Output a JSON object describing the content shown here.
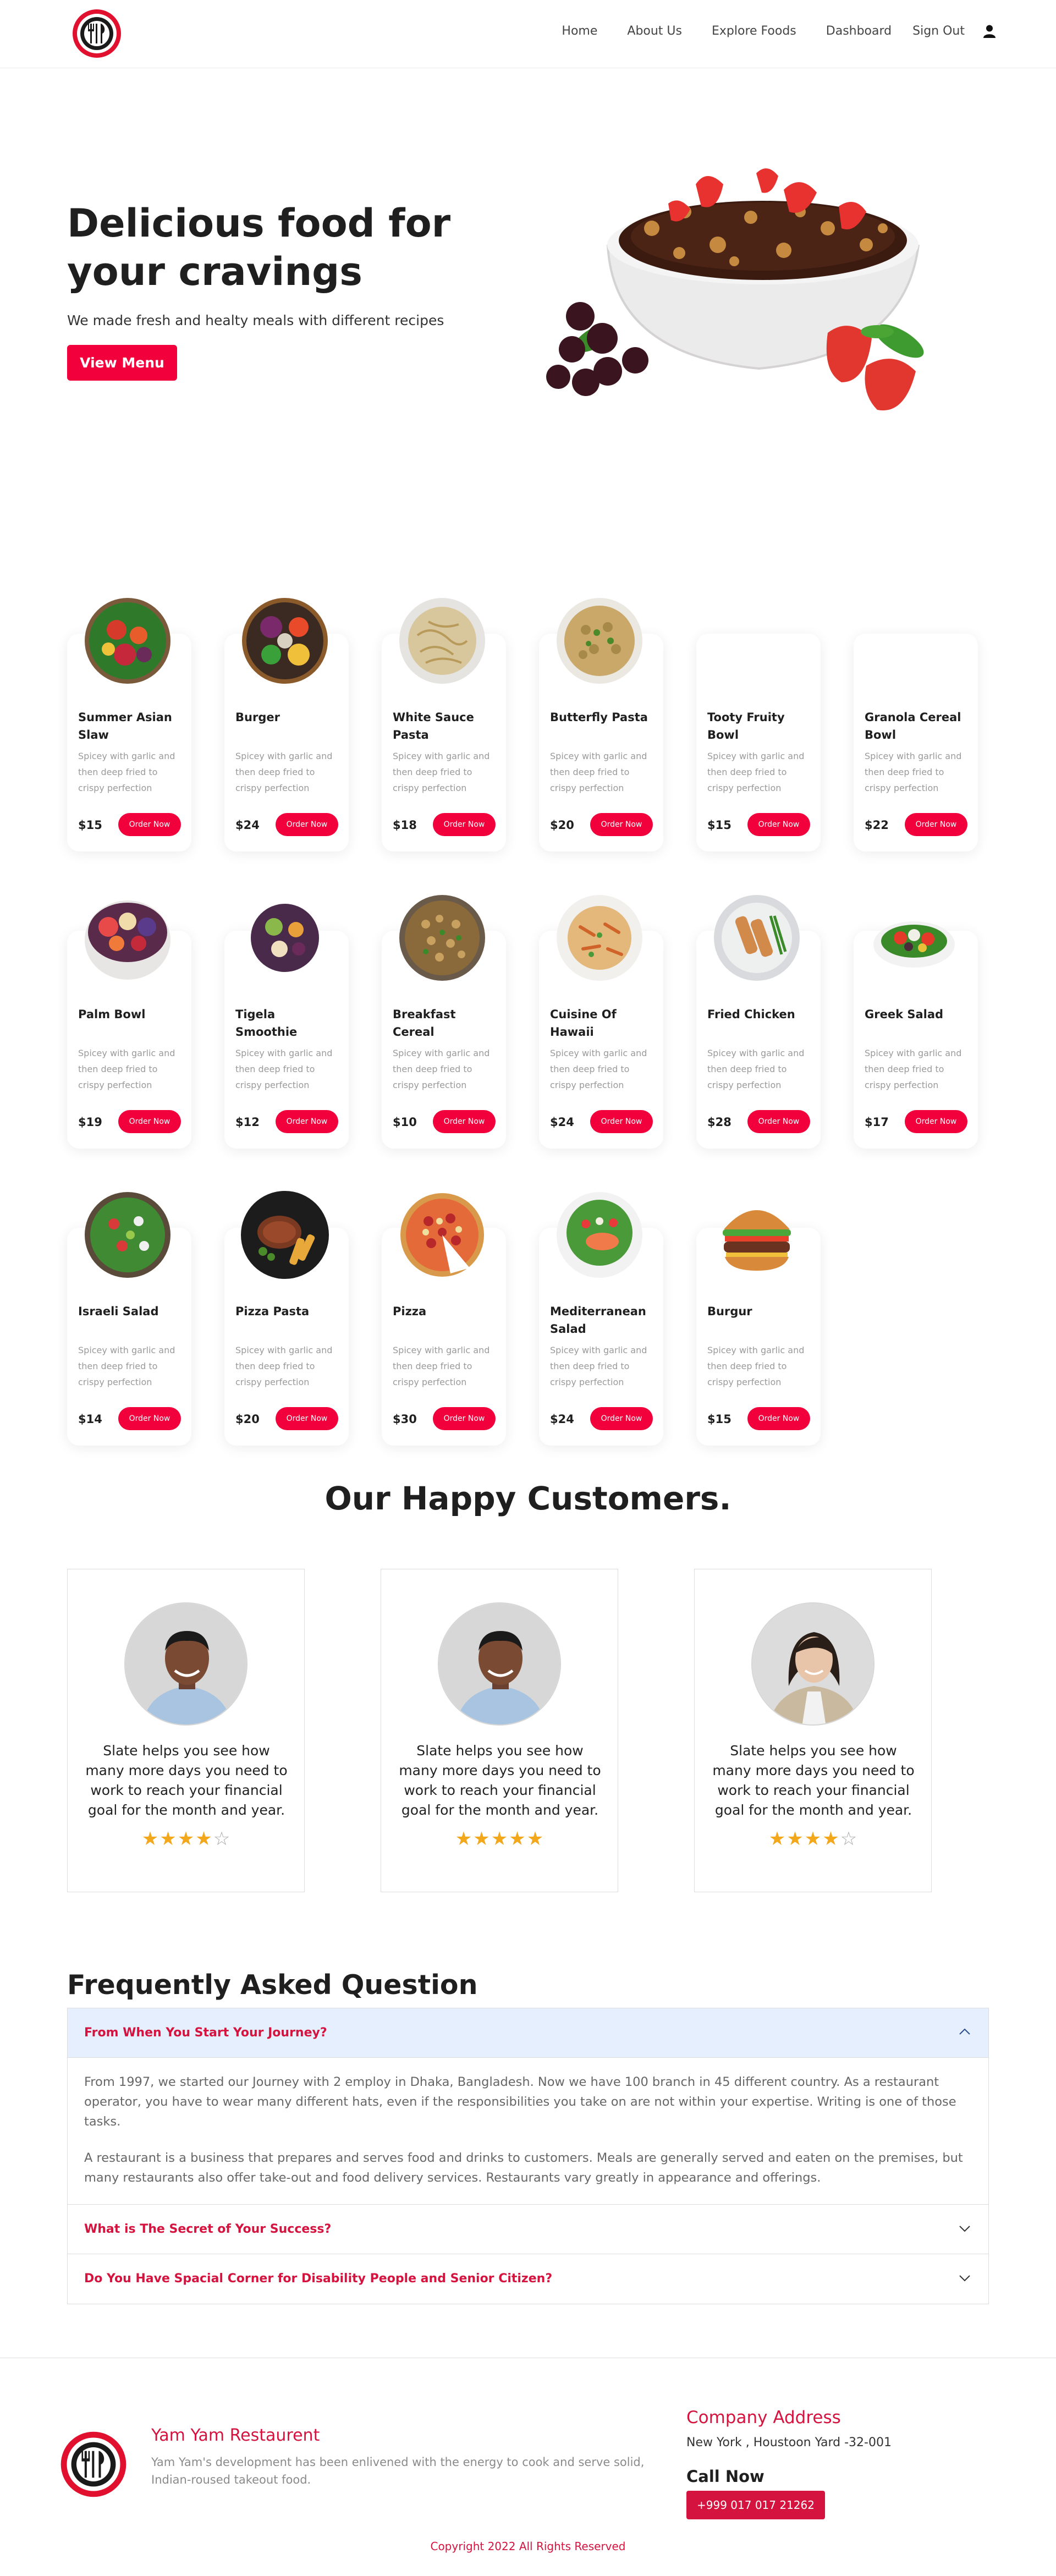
{
  "nav": {
    "items": [
      {
        "label": "Home",
        "icon": ""
      },
      {
        "label": "About Us",
        "icon": ""
      },
      {
        "label": "Explore Foods",
        "icon": ""
      },
      {
        "label": "Dashboard",
        "icon": ""
      },
      {
        "label": "Sign Out",
        "icon": ""
      }
    ],
    "user_icon": "user-icon",
    "logo_icon": "cutlery-logo"
  },
  "hero": {
    "title": "Delicious food for your cravings",
    "subtitle": "We made fresh and healty meals with different recipes",
    "button": "View Menu",
    "image": "chocolate-granola-bowl-with-strawberries"
  },
  "foods": [
    {
      "name": "Summer Asian Slaw",
      "desc": "Spicey with garlic and then deep fried to crispy perfection",
      "price": "$15",
      "button": "Order Now",
      "has_image": true,
      "image": "slaw-bowl"
    },
    {
      "name": "Burger",
      "desc": "Spicey with garlic and then deep fried to crispy perfection",
      "price": "$24",
      "button": "Order Now",
      "has_image": true,
      "image": "colorful-bowl"
    },
    {
      "name": "White Sauce Pasta",
      "desc": "Spicey with garlic and then deep fried to crispy perfection",
      "price": "$18",
      "button": "Order Now",
      "has_image": true,
      "image": "pasta-plate"
    },
    {
      "name": "Butterfly Pasta",
      "desc": "Spicey with garlic and then deep fried to crispy perfection",
      "price": "$20",
      "button": "Order Now",
      "has_image": true,
      "image": "farfalle-plate"
    },
    {
      "name": "Tooty Fruity Bowl",
      "desc": "Spicey with garlic and then deep fried to crispy perfection",
      "price": "$15",
      "button": "Order Now",
      "has_image": false,
      "image": ""
    },
    {
      "name": "Granola Cereal Bowl",
      "desc": "Spicey with garlic and then deep fried to crispy perfection",
      "price": "$22",
      "button": "Order Now",
      "has_image": false,
      "image": ""
    },
    {
      "name": "Palm Bowl",
      "desc": "Spicey with garlic and then deep fried to crispy perfection",
      "price": "$19",
      "button": "Order Now",
      "has_image": true,
      "image": "fruit-bowl"
    },
    {
      "name": "Tigela Smoothie",
      "desc": "Spicey with garlic and then deep fried to crispy perfection",
      "price": "$12",
      "button": "Order Now",
      "has_image": true,
      "image": "smoothie-bowl"
    },
    {
      "name": "Breakfast Cereal",
      "desc": "Spicey with garlic and then deep fried to crispy perfection",
      "price": "$10",
      "button": "Order Now",
      "has_image": true,
      "image": "cereal-bowl"
    },
    {
      "name": "Cuisine Of Hawaii",
      "desc": "Spicey with garlic and then deep fried to crispy perfection",
      "price": "$24",
      "button": "Order Now",
      "has_image": true,
      "image": "penne-plate"
    },
    {
      "name": "Fried Chicken",
      "desc": "Spicey with garlic and then deep fried to crispy perfection",
      "price": "$28",
      "button": "Order Now",
      "has_image": true,
      "image": "chicken-plate"
    },
    {
      "name": "Greek Salad",
      "desc": "Spicey with garlic and then deep fried to crispy perfection",
      "price": "$17",
      "button": "Order Now",
      "has_image": true,
      "image": "salad-bowl"
    },
    {
      "name": "Israeli Salad",
      "desc": "Spicey with garlic and then deep fried to crispy perfection",
      "price": "$14",
      "button": "Order Now",
      "has_image": true,
      "image": "green-salad-bowl"
    },
    {
      "name": "Pizza Pasta",
      "desc": "Spicey with garlic and then deep fried to crispy perfection",
      "price": "$20",
      "button": "Order Now",
      "has_image": true,
      "image": "steak-plate"
    },
    {
      "name": "Pizza",
      "desc": "Spicey with garlic and then deep fried to crispy perfection",
      "price": "$30",
      "button": "Order Now",
      "has_image": true,
      "image": "pizza"
    },
    {
      "name": "Mediterranean Salad",
      "desc": "Spicey with garlic and then deep fried to crispy perfection",
      "price": "$24",
      "button": "Order Now",
      "has_image": true,
      "image": "salmon-salad"
    },
    {
      "name": "Burgur",
      "desc": "Spicey with garlic and then deep fried to crispy perfection",
      "price": "$15",
      "button": "Order Now",
      "has_image": true,
      "image": "burger"
    }
  ],
  "customers": {
    "title": "Our Happy Customers.",
    "items": [
      {
        "quote": "Slate helps you see how many more days you need to work to reach your financial goal for the month and year.",
        "rating": 4,
        "avatar": "man-smiling"
      },
      {
        "quote": "Slate helps you see how many more days you need to work to reach your financial goal for the month and year.",
        "rating": 5,
        "avatar": "man-smiling"
      },
      {
        "quote": "Slate helps you see how many more days you need to work to reach your financial goal for the month and year.",
        "rating": 4,
        "avatar": "woman-smiling"
      }
    ]
  },
  "faq": {
    "title": "Frequently Asked Question",
    "items": [
      {
        "question": "From When You Start Your Journey?",
        "open": true,
        "answer": [
          "From 1997, we started our Journey with 2 employ in Dhaka, Bangladesh. Now we have 100 branch in 45 different country. As a restaurant operator, you have to wear many different hats, even if the responsibilities you take on are not within your expertise. Writing is one of those tasks.",
          "A restaurant is a business that prepares and serves food and drinks to customers. Meals are generally served and eaten on the premises, but many restaurants also offer take-out and food delivery services. Restaurants vary greatly in appearance and offerings."
        ]
      },
      {
        "question": "What is The Secret of Your Success?",
        "open": false,
        "answer": []
      },
      {
        "question": "Do You Have Spacial Corner for Disability People and Senior Citizen?",
        "open": false,
        "answer": []
      }
    ]
  },
  "footer": {
    "name": "Yam Yam Restaurent",
    "desc": "Yam Yam's development has been enlivened with the energy to cook and serve solid, Indian-roused takeout food.",
    "address_title": "Company Address",
    "address": "New York , Houstoon Yard -32-001",
    "call_title": "Call Now",
    "phone": "+999 017 017 21262",
    "copyright": "Copyright 2022 All Rights Reserved"
  },
  "colors": {
    "accent": "#f2003c",
    "accent_dark": "#d4133f",
    "star": "#f3a71a",
    "faq_open_bg": "#e6effd"
  }
}
